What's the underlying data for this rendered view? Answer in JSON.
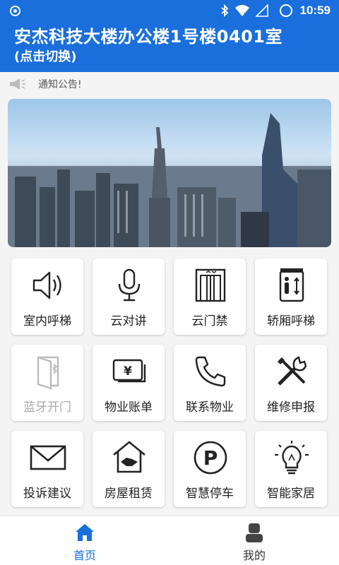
{
  "status_bar": {
    "time": "10:59"
  },
  "header": {
    "title": "安杰科技大楼办公楼1号楼0401室",
    "subtitle": "(点击切换)"
  },
  "notice": {
    "text": "通知公告!"
  },
  "colors": {
    "primary": "#1a6fdc",
    "text": "#222222",
    "disabled": "#aaaaaa"
  },
  "grid": [
    {
      "label": "室内呼梯",
      "icon": "speaker-icon",
      "disabled": false
    },
    {
      "label": "云对讲",
      "icon": "microphone-icon",
      "disabled": false
    },
    {
      "label": "云门禁",
      "icon": "elevator-door-icon",
      "disabled": false
    },
    {
      "label": "轿厢呼梯",
      "icon": "elevator-call-icon",
      "disabled": false
    },
    {
      "label": "蓝牙开门",
      "icon": "bluetooth-door-icon",
      "disabled": true
    },
    {
      "label": "物业账单",
      "icon": "money-bill-icon",
      "disabled": false
    },
    {
      "label": "联系物业",
      "icon": "phone-icon",
      "disabled": false
    },
    {
      "label": "维修申报",
      "icon": "repair-tools-icon",
      "disabled": false
    },
    {
      "label": "投诉建议",
      "icon": "envelope-icon",
      "disabled": false
    },
    {
      "label": "房屋租赁",
      "icon": "house-handshake-icon",
      "disabled": false
    },
    {
      "label": "智慧停车",
      "icon": "parking-icon",
      "disabled": false
    },
    {
      "label": "智能家居",
      "icon": "lightbulb-icon",
      "disabled": false
    }
  ],
  "bottom_nav": [
    {
      "label": "首页",
      "icon": "home-icon",
      "active": true
    },
    {
      "label": "我的",
      "icon": "user-icon",
      "active": false
    }
  ]
}
